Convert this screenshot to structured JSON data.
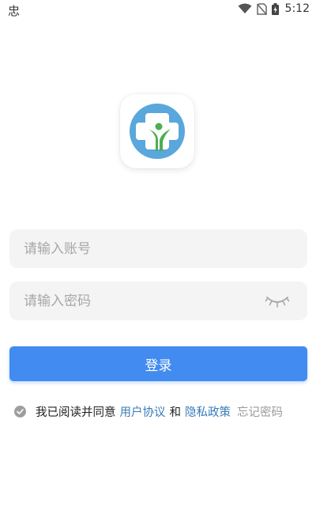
{
  "status_bar": {
    "left_icon_glyph": "忠",
    "time": "5:12",
    "icons": [
      "wifi-icon",
      "no-sim-icon",
      "battery-icon"
    ]
  },
  "logo": {
    "icon": "medical-cross-person-logo"
  },
  "form": {
    "account_placeholder": "请输入账号",
    "password_placeholder": "请输入密码",
    "account_value": "",
    "password_value": "",
    "password_toggle_icon": "eye-closed-icon"
  },
  "login_button_label": "登录",
  "agreement": {
    "prefix": "我已阅读并同意",
    "user_agreement": "用户协议",
    "and": "和",
    "privacy_policy": "隐私政策",
    "checked": false
  },
  "forgot_password": "忘记密码",
  "colors": {
    "primary": "#428bf0",
    "link": "#3a7ab8",
    "logo_blue": "#5aa7dc",
    "logo_green": "#4caf50"
  }
}
